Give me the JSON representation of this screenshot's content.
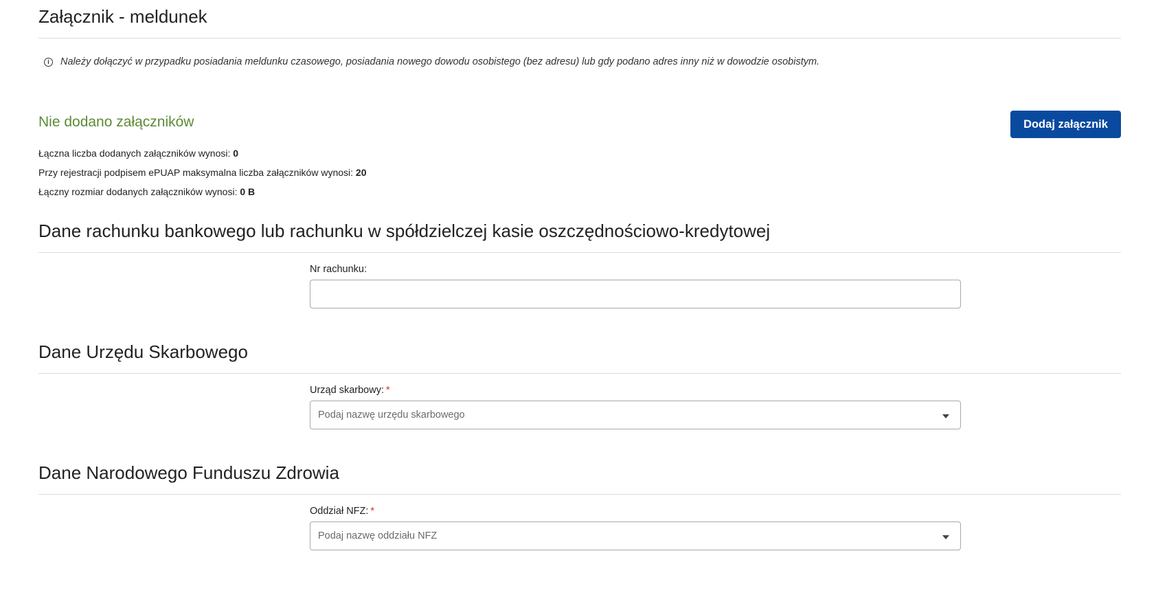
{
  "attachment_section": {
    "title": "Załącznik - meldunek",
    "info_icon": "info-circle-icon",
    "info_text": "Należy dołączyć w przypadku posiadania meldunku czasowego, posiadania nowego dowodu osobistego (bez adresu) lub gdy podano adres inny niż w dowodzie osobistym.",
    "status_text": "Nie dodano załączników",
    "status_color": "#5b8c35",
    "add_button_label": "Dodaj załącznik",
    "add_button_color": "#0a4a9e",
    "stats": [
      {
        "label": "Łączna liczba dodanych załączników wynosi:",
        "value": "0"
      },
      {
        "label": "Przy rejestracji podpisem ePUAP maksymalna liczba załączników wynosi:",
        "value": "20"
      },
      {
        "label": "Łączny rozmiar dodanych załączników wynosi:",
        "value": "0 B"
      }
    ]
  },
  "bank_section": {
    "title": "Dane rachunku bankowego lub rachunku w spółdzielczej kasie oszczędnościowo-kredytowej",
    "account_label": "Nr rachunku:",
    "account_value": ""
  },
  "tax_office_section": {
    "title": "Dane Urzędu Skarbowego",
    "field_label": "Urząd skarbowy:",
    "required_mark": "*",
    "placeholder": "Podaj nazwę urzędu skarbowego",
    "dropdown_icon": "caret-down-icon"
  },
  "nfz_section": {
    "title": "Dane Narodowego Funduszu Zdrowia",
    "field_label": "Oddział NFZ:",
    "required_mark": "*",
    "placeholder": "Podaj nazwę oddziału NFZ",
    "dropdown_icon": "caret-down-icon"
  }
}
